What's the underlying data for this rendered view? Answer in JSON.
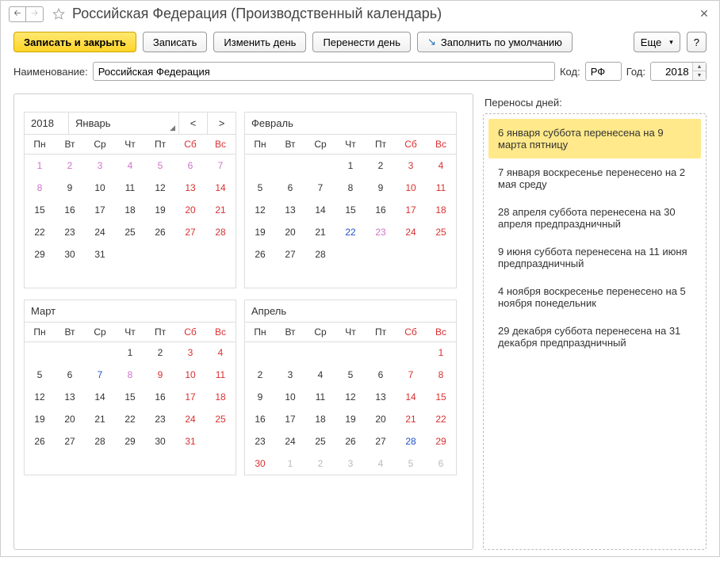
{
  "title": "Российская Федерация (Производственный календарь)",
  "toolbar": {
    "save_close": "Записать и закрыть",
    "save": "Записать",
    "change_day": "Изменить день",
    "move_day": "Перенести день",
    "fill_default": "Заполнить по умолчанию",
    "more": "Еще",
    "help": "?"
  },
  "form": {
    "name_label": "Наименование:",
    "name_value": "Российская Федерация",
    "code_label": "Код:",
    "code_value": "РФ",
    "year_label": "Год:",
    "year_value": "2018"
  },
  "weekday_labels": [
    "Пн",
    "Вт",
    "Ср",
    "Чт",
    "Пт",
    "Сб",
    "Вс"
  ],
  "year_display": "2018",
  "months": [
    {
      "name": "Январь",
      "show_year": true,
      "days": [
        [
          {
            "n": 1,
            "c": "d-moved"
          },
          {
            "n": 2,
            "c": "d-moved"
          },
          {
            "n": 3,
            "c": "d-moved"
          },
          {
            "n": 4,
            "c": "d-moved"
          },
          {
            "n": 5,
            "c": "d-moved"
          },
          {
            "n": 6,
            "c": "d-moved"
          },
          {
            "n": 7,
            "c": "d-moved"
          }
        ],
        [
          {
            "n": 8,
            "c": "d-moved"
          },
          {
            "n": 9
          },
          {
            "n": 10
          },
          {
            "n": 11
          },
          {
            "n": 12
          },
          {
            "n": 13,
            "c": "d-we"
          },
          {
            "n": 14,
            "c": "d-we"
          }
        ],
        [
          {
            "n": 15
          },
          {
            "n": 16
          },
          {
            "n": 17
          },
          {
            "n": 18
          },
          {
            "n": 19
          },
          {
            "n": 20,
            "c": "d-we"
          },
          {
            "n": 21,
            "c": "d-we"
          }
        ],
        [
          {
            "n": 22
          },
          {
            "n": 23
          },
          {
            "n": 24
          },
          {
            "n": 25
          },
          {
            "n": 26
          },
          {
            "n": 27,
            "c": "d-we"
          },
          {
            "n": 28,
            "c": "d-we"
          }
        ],
        [
          {
            "n": 29
          },
          {
            "n": 30
          },
          {
            "n": 31
          },
          null,
          null,
          null,
          null
        ],
        [
          null,
          null,
          null,
          null,
          null,
          null,
          null
        ]
      ]
    },
    {
      "name": "Февраль",
      "days": [
        [
          null,
          null,
          null,
          {
            "n": 1
          },
          {
            "n": 2
          },
          {
            "n": 3,
            "c": "d-we"
          },
          {
            "n": 4,
            "c": "d-we"
          }
        ],
        [
          {
            "n": 5
          },
          {
            "n": 6
          },
          {
            "n": 7
          },
          {
            "n": 8
          },
          {
            "n": 9
          },
          {
            "n": 10,
            "c": "d-we"
          },
          {
            "n": 11,
            "c": "d-we"
          }
        ],
        [
          {
            "n": 12
          },
          {
            "n": 13
          },
          {
            "n": 14
          },
          {
            "n": 15
          },
          {
            "n": 16
          },
          {
            "n": 17,
            "c": "d-we"
          },
          {
            "n": 18,
            "c": "d-we"
          }
        ],
        [
          {
            "n": 19
          },
          {
            "n": 20
          },
          {
            "n": 21
          },
          {
            "n": 22,
            "c": "d-pre"
          },
          {
            "n": 23,
            "c": "d-moved"
          },
          {
            "n": 24,
            "c": "d-we"
          },
          {
            "n": 25,
            "c": "d-we"
          }
        ],
        [
          {
            "n": 26
          },
          {
            "n": 27
          },
          {
            "n": 28
          },
          null,
          null,
          null,
          null
        ],
        [
          null,
          null,
          null,
          null,
          null,
          null,
          null
        ]
      ]
    },
    {
      "name": "Март",
      "days": [
        [
          null,
          null,
          null,
          {
            "n": 1
          },
          {
            "n": 2
          },
          {
            "n": 3,
            "c": "d-we"
          },
          {
            "n": 4,
            "c": "d-we"
          }
        ],
        [
          {
            "n": 5
          },
          {
            "n": 6
          },
          {
            "n": 7,
            "c": "d-pre"
          },
          {
            "n": 8,
            "c": "d-moved"
          },
          {
            "n": 9,
            "c": "d-holiday"
          },
          {
            "n": 10,
            "c": "d-we"
          },
          {
            "n": 11,
            "c": "d-we"
          }
        ],
        [
          {
            "n": 12
          },
          {
            "n": 13
          },
          {
            "n": 14
          },
          {
            "n": 15
          },
          {
            "n": 16
          },
          {
            "n": 17,
            "c": "d-we"
          },
          {
            "n": 18,
            "c": "d-we"
          }
        ],
        [
          {
            "n": 19
          },
          {
            "n": 20
          },
          {
            "n": 21
          },
          {
            "n": 22
          },
          {
            "n": 23
          },
          {
            "n": 24,
            "c": "d-we"
          },
          {
            "n": 25,
            "c": "d-we"
          }
        ],
        [
          {
            "n": 26
          },
          {
            "n": 27
          },
          {
            "n": 28
          },
          {
            "n": 29
          },
          {
            "n": 30
          },
          {
            "n": 31,
            "c": "d-we"
          },
          null
        ],
        [
          null,
          null,
          null,
          null,
          null,
          null,
          null
        ]
      ]
    },
    {
      "name": "Апрель",
      "days": [
        [
          null,
          null,
          null,
          null,
          null,
          null,
          {
            "n": 1,
            "c": "d-we"
          }
        ],
        [
          {
            "n": 2
          },
          {
            "n": 3
          },
          {
            "n": 4
          },
          {
            "n": 5
          },
          {
            "n": 6
          },
          {
            "n": 7,
            "c": "d-we"
          },
          {
            "n": 8,
            "c": "d-we"
          }
        ],
        [
          {
            "n": 9
          },
          {
            "n": 10
          },
          {
            "n": 11
          },
          {
            "n": 12
          },
          {
            "n": 13
          },
          {
            "n": 14,
            "c": "d-we"
          },
          {
            "n": 15,
            "c": "d-we"
          }
        ],
        [
          {
            "n": 16
          },
          {
            "n": 17
          },
          {
            "n": 18
          },
          {
            "n": 19
          },
          {
            "n": 20
          },
          {
            "n": 21,
            "c": "d-we"
          },
          {
            "n": 22,
            "c": "d-we"
          }
        ],
        [
          {
            "n": 23
          },
          {
            "n": 24
          },
          {
            "n": 25
          },
          {
            "n": 26
          },
          {
            "n": 27
          },
          {
            "n": 28,
            "c": "d-pre"
          },
          {
            "n": 29,
            "c": "d-we"
          }
        ],
        [
          {
            "n": 30,
            "c": "d-holiday"
          },
          {
            "n": 1,
            "c": "d-off"
          },
          {
            "n": 2,
            "c": "d-off"
          },
          {
            "n": 3,
            "c": "d-off"
          },
          {
            "n": 4,
            "c": "d-off"
          },
          {
            "n": 5,
            "c": "d-off"
          },
          {
            "n": 6,
            "c": "d-off"
          }
        ]
      ]
    }
  ],
  "transfers": {
    "title": "Переносы дней:",
    "items": [
      {
        "text": "6 января суббота перенесена на 9 марта пятницу",
        "selected": true
      },
      {
        "text": "7 января воскресенье перенесено на 2 мая среду"
      },
      {
        "text": "28 апреля суббота перенесена на 30 апреля предпраздничный"
      },
      {
        "text": "9 июня суббота перенесена на 11 июня предпраздничный"
      },
      {
        "text": "4 ноября воскресенье перенесено на 5 ноября понедельник"
      },
      {
        "text": "29 декабря суббота перенесена на 31 декабря предпраздничный"
      }
    ]
  }
}
